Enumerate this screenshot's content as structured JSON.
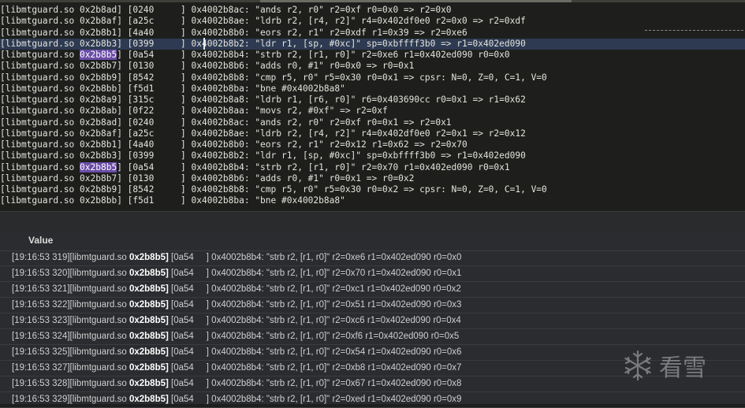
{
  "trace_lines": [
    {
      "lib": "[libmtguard.so ",
      "addr": "0x2b8ad",
      "rest": "] [0240     ] 0x4002b8ac: \"ands r2, r0\" r2=0xf r0=0x0 => r2=0x0",
      "hl": false,
      "match": false
    },
    {
      "lib": "[libmtguard.so ",
      "addr": "0x2b8af",
      "rest": "] [a25c     ] 0x4002b8ae: \"ldrb r2, [r4, r2]\" r4=0x402df0e0 r2=0x0 => r2=0xdf",
      "hl": false,
      "match": false
    },
    {
      "lib": "[libmtguard.so ",
      "addr": "0x2b8b1",
      "rest": "] [4a40     ] 0x4002b8b0: \"eors r2, r1\" r2=0xdf r1=0x39 => r2=0xe6",
      "hl": false,
      "match": false
    },
    {
      "lib": "[libmtguard.so ",
      "addr": "0x2b8b3",
      "rest": "] [0399     ] 0x4002b8b2: \"ldr r1, [sp, #0xc]\" sp=0xbffff3b0 => r1=0x402ed090",
      "hl": true,
      "match": false
    },
    {
      "lib": "[libmtguard.so ",
      "addr": "0x2b8b5",
      "rest": "] [0a54     ] 0x4002b8b4: \"strb r2, [r1, r0]\" r2=0xe6 r1=0x402ed090 r0=0x0",
      "hl": false,
      "match": true
    },
    {
      "lib": "[libmtguard.so ",
      "addr": "0x2b8b7",
      "rest": "] [0130     ] 0x4002b8b6: \"adds r0, #1\" r0=0x0 => r0=0x1",
      "hl": false,
      "match": false
    },
    {
      "lib": "[libmtguard.so ",
      "addr": "0x2b8b9",
      "rest": "] [8542     ] 0x4002b8b8: \"cmp r5, r0\" r5=0x30 r0=0x1 => cpsr: N=0, Z=0, C=1, V=0",
      "hl": false,
      "match": false
    },
    {
      "lib": "[libmtguard.so ",
      "addr": "0x2b8bb",
      "rest": "] [f5d1     ] 0x4002b8ba: \"bne #0x4002b8a8\"",
      "hl": false,
      "match": false
    },
    {
      "lib": "[libmtguard.so ",
      "addr": "0x2b8a9",
      "rest": "] [315c     ] 0x4002b8a8: \"ldrb r1, [r6, r0]\" r6=0x403690cc r0=0x1 => r1=0x62",
      "hl": false,
      "match": false
    },
    {
      "lib": "[libmtguard.so ",
      "addr": "0x2b8ab",
      "rest": "] [0f22     ] 0x4002b8aa: \"movs r2, #0xf\" => r2=0xf",
      "hl": false,
      "match": false
    },
    {
      "lib": "[libmtguard.so ",
      "addr": "0x2b8ad",
      "rest": "] [0240     ] 0x4002b8ac: \"ands r2, r0\" r2=0xf r0=0x1 => r2=0x1",
      "hl": false,
      "match": false
    },
    {
      "lib": "[libmtguard.so ",
      "addr": "0x2b8af",
      "rest": "] [a25c     ] 0x4002b8ae: \"ldrb r2, [r4, r2]\" r4=0x402df0e0 r2=0x1 => r2=0x12",
      "hl": false,
      "match": false
    },
    {
      "lib": "[libmtguard.so ",
      "addr": "0x2b8b1",
      "rest": "] [4a40     ] 0x4002b8b0: \"eors r2, r1\" r2=0x12 r1=0x62 => r2=0x70",
      "hl": false,
      "match": false
    },
    {
      "lib": "[libmtguard.so ",
      "addr": "0x2b8b3",
      "rest": "] [0399     ] 0x4002b8b2: \"ldr r1, [sp, #0xc]\" sp=0xbffff3b0 => r1=0x402ed090",
      "hl": false,
      "match": false
    },
    {
      "lib": "[libmtguard.so ",
      "addr": "0x2b8b5",
      "rest": "] [0a54     ] 0x4002b8b4: \"strb r2, [r1, r0]\" r2=0x70 r1=0x402ed090 r0=0x1",
      "hl": false,
      "match": true
    },
    {
      "lib": "[libmtguard.so ",
      "addr": "0x2b8b7",
      "rest": "] [0130     ] 0x4002b8b6: \"adds r0, #1\" r0=0x1 => r0=0x2",
      "hl": false,
      "match": false
    },
    {
      "lib": "[libmtguard.so ",
      "addr": "0x2b8b9",
      "rest": "] [8542     ] 0x4002b8b8: \"cmp r5, r0\" r5=0x30 r0=0x2 => cpsr: N=0, Z=0, C=1, V=0",
      "hl": false,
      "match": false
    },
    {
      "lib": "[libmtguard.so ",
      "addr": "0x2b8bb",
      "rest": "] [f5d1     ] 0x4002b8ba: \"bne #0x4002b8a8\"",
      "hl": false,
      "match": false
    }
  ],
  "results_header": "Value",
  "results": [
    {
      "prefix": "[19:16:53 319][libmtguard.so ",
      "addr": "0x2b8b5]",
      "rest": " [0a54     ] 0x4002b8b4: \"strb r2, [r1, r0]\" r2=0xe6 r1=0x402ed090 r0=0x0"
    },
    {
      "prefix": "[19:16:53 320][libmtguard.so ",
      "addr": "0x2b8b5]",
      "rest": " [0a54     ] 0x4002b8b4: \"strb r2, [r1, r0]\" r2=0x70 r1=0x402ed090 r0=0x1"
    },
    {
      "prefix": "[19:16:53 321][libmtguard.so ",
      "addr": "0x2b8b5]",
      "rest": " [0a54     ] 0x4002b8b4: \"strb r2, [r1, r0]\" r2=0xc1 r1=0x402ed090 r0=0x2"
    },
    {
      "prefix": "[19:16:53 322][libmtguard.so ",
      "addr": "0x2b8b5]",
      "rest": " [0a54     ] 0x4002b8b4: \"strb r2, [r1, r0]\" r2=0x51 r1=0x402ed090 r0=0x3"
    },
    {
      "prefix": "[19:16:53 323][libmtguard.so ",
      "addr": "0x2b8b5]",
      "rest": " [0a54     ] 0x4002b8b4: \"strb r2, [r1, r0]\" r2=0xc6 r1=0x402ed090 r0=0x4"
    },
    {
      "prefix": "[19:16:53 324][libmtguard.so ",
      "addr": "0x2b8b5]",
      "rest": " [0a54     ] 0x4002b8b4: \"strb r2, [r1, r0]\" r2=0xf6 r1=0x402ed090 r0=0x5"
    },
    {
      "prefix": "[19:16:53 325][libmtguard.so ",
      "addr": "0x2b8b5]",
      "rest": " [0a54     ] 0x4002b8b4: \"strb r2, [r1, r0]\" r2=0x54 r1=0x402ed090 r0=0x6"
    },
    {
      "prefix": "[19:16:53 327][libmtguard.so ",
      "addr": "0x2b8b5]",
      "rest": " [0a54     ] 0x4002b8b4: \"strb r2, [r1, r0]\" r2=0xb8 r1=0x402ed090 r0=0x7"
    },
    {
      "prefix": "[19:16:53 328][libmtguard.so ",
      "addr": "0x2b8b5]",
      "rest": " [0a54     ] 0x4002b8b4: \"strb r2, [r1, r0]\" r2=0x67 r1=0x402ed090 r0=0x8"
    },
    {
      "prefix": "[19:16:53 329][libmtguard.so ",
      "addr": "0x2b8b5]",
      "rest": " [0a54     ] 0x4002b8b4: \"strb r2, [r1, r0]\" r2=0xed r1=0x402ed090 r0=0x9"
    }
  ],
  "watermark": {
    "icon": "snowflake-icon",
    "text": "看雪"
  },
  "colors": {
    "editor_bg": "#1e1f1c",
    "highlight_line": "#2d3a52",
    "match_bg": "#6a4ca7",
    "panel_bg": "#2b2c2f"
  }
}
